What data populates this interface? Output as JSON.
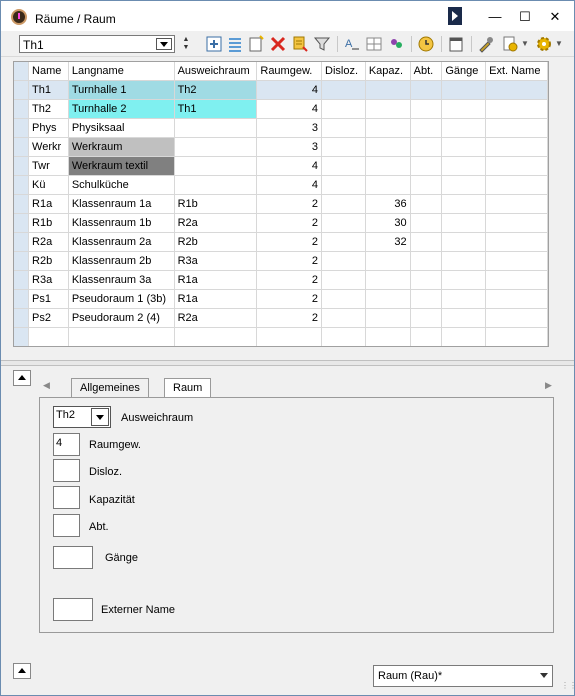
{
  "window": {
    "title": "Räume / Raum"
  },
  "toolbar": {
    "selector_value": "Th1"
  },
  "grid": {
    "headers": [
      "Name",
      "Langname",
      "Ausweichraum",
      "Raumgew.",
      "Disloz.",
      "Kapaz.",
      "Abt.",
      "Gänge",
      "Ext. Name"
    ],
    "rows": [
      [
        "Th1",
        "Turnhalle 1",
        "Th2",
        "4",
        "",
        "",
        "",
        "",
        ""
      ],
      [
        "Th2",
        "Turnhalle 2",
        "Th1",
        "4",
        "",
        "",
        "",
        "",
        ""
      ],
      [
        "Phys",
        "Physiksaal",
        "",
        "3",
        "",
        "",
        "",
        "",
        ""
      ],
      [
        "Werkr",
        "Werkraum",
        "",
        "3",
        "",
        "",
        "",
        "",
        ""
      ],
      [
        "Twr",
        "Werkraum textil",
        "",
        "4",
        "",
        "",
        "",
        "",
        ""
      ],
      [
        "Kü",
        "Schulküche",
        "",
        "4",
        "",
        "",
        "",
        "",
        ""
      ],
      [
        "R1a",
        "Klassenraum 1a",
        "R1b",
        "2",
        "",
        "36",
        "",
        "",
        ""
      ],
      [
        "R1b",
        "Klassenraum 1b",
        "R2a",
        "2",
        "",
        "30",
        "",
        "",
        ""
      ],
      [
        "R2a",
        "Klassenraum 2a",
        "R2b",
        "2",
        "",
        "32",
        "",
        "",
        ""
      ],
      [
        "R2b",
        "Klassenraum 2b",
        "R3a",
        "2",
        "",
        "",
        "",
        "",
        ""
      ],
      [
        "R3a",
        "Klassenraum 3a",
        "R1a",
        "2",
        "",
        "",
        "",
        "",
        ""
      ],
      [
        "Ps1",
        "Pseudoraum 1 (3b)",
        "R1a",
        "2",
        "",
        "",
        "",
        "",
        ""
      ],
      [
        "Ps2",
        "Pseudoraum 2 (4)",
        "R2a",
        "2",
        "",
        "",
        "",
        "",
        ""
      ]
    ],
    "row_colors": {
      "Th1_lang": "#a0dbe4",
      "Th1_aus": "#a0dbe4",
      "Th2_lang": "#7ff0f0",
      "Th2_aus": "#7ff0f0",
      "Werkr_lang": "#c0c0c0",
      "Twr_lang": "#808080"
    }
  },
  "tabs": [
    {
      "label": "Allgemeines"
    },
    {
      "label": "Raum"
    }
  ],
  "form": {
    "ausweichraum_value": "Th2",
    "ausweichraum_label": "Ausweichraum",
    "raumgew_value": "4",
    "raumgew_label": "Raumgew.",
    "disloz_label": "Disloz.",
    "kapazitaet_label": "Kapazität",
    "abt_label": "Abt.",
    "gaenge_label": "Gänge",
    "ext_name_label": "Externer Name"
  },
  "bottom": {
    "view_selector": "Raum (Rau)*"
  }
}
